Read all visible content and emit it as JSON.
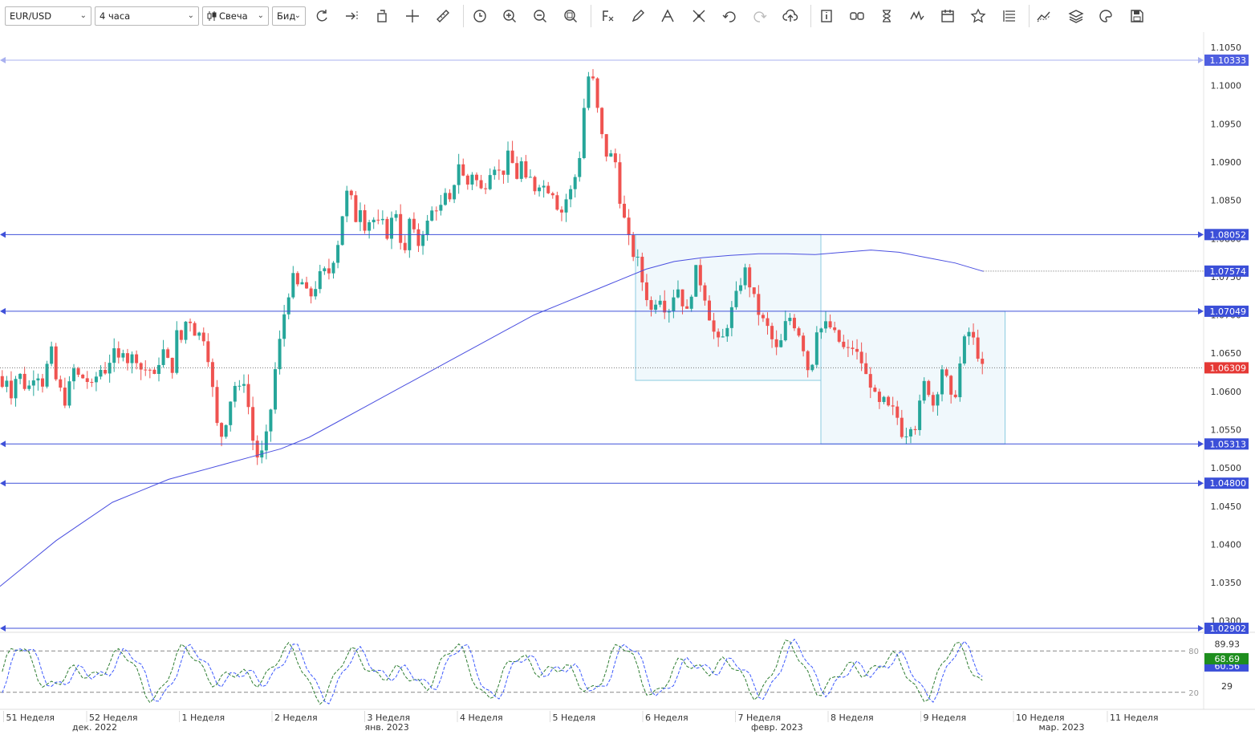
{
  "toolbar": {
    "symbol": "EUR/USD",
    "timeframe": "4 часа",
    "chart_type": "Свеча",
    "price_type": "Бид"
  },
  "colors": {
    "bull": "#26a69a",
    "bear": "#ef5350",
    "level_line": "#3f51d9",
    "ma": "#4a4fe0",
    "box_fill": "#e6f3fa",
    "box_stroke": "#8ccbe0",
    "current_price": "#e53935",
    "stoch_k": "#2e7d32",
    "stoch_d": "#3d5afe"
  },
  "price_axis": {
    "ticks": [
      "1.1050",
      "1.1000",
      "1.0950",
      "1.0900",
      "1.0850",
      "1.0800",
      "1.0750",
      "1.0700",
      "1.0650",
      "1.0600",
      "1.0550",
      "1.0500",
      "1.0450",
      "1.0400",
      "1.0350",
      "1.0300"
    ]
  },
  "levels": [
    {
      "label": "1.10333",
      "price": 1.10333,
      "style": "light"
    },
    {
      "label": "1.08052",
      "price": 1.08052,
      "style": "solid"
    },
    {
      "label": "1.07049",
      "price": 1.07049,
      "style": "solid"
    },
    {
      "label": "1.05313",
      "price": 1.05313,
      "style": "solid"
    },
    {
      "label": "1.04800",
      "price": 1.048,
      "style": "solid"
    },
    {
      "label": "1.02902",
      "price": 1.02902,
      "style": "solid"
    }
  ],
  "ma_label": {
    "label": "1.07574",
    "price": 1.07574
  },
  "current_price": {
    "label": "1.06309",
    "price": 1.06309
  },
  "rectangles": [
    {
      "x1": 0.528,
      "x2": 0.682,
      "top": 1.08052,
      "bottom": 1.06145
    },
    {
      "x1": 0.682,
      "x2": 0.835,
      "top": 1.07049,
      "bottom": 1.05313
    }
  ],
  "stochastic": {
    "upper_level": "80",
    "lower_level": "20",
    "upper_value": 89.93,
    "lower_value": 29,
    "upper_value_label": "89.93",
    "lower_value_label": "29",
    "k_value": "68.69",
    "d_value": "60.56"
  },
  "time_axis": {
    "weeks": [
      {
        "label": "51 Неделя",
        "x": 0.003
      },
      {
        "label": "52 Неделя",
        "x": 0.072
      },
      {
        "label": "1 Неделя",
        "x": 0.149
      },
      {
        "label": "2 Неделя",
        "x": 0.226
      },
      {
        "label": "3 Неделя",
        "x": 0.303
      },
      {
        "label": "4 Неделя",
        "x": 0.38
      },
      {
        "label": "5 Неделя",
        "x": 0.457
      },
      {
        "label": "6 Неделя",
        "x": 0.534
      },
      {
        "label": "7 Неделя",
        "x": 0.611
      },
      {
        "label": "8 Неделя",
        "x": 0.688
      },
      {
        "label": "9 Неделя",
        "x": 0.765
      },
      {
        "label": "10 Неделя",
        "x": 0.842
      },
      {
        "label": "11 Неделя",
        "x": 0.92
      }
    ],
    "months": [
      {
        "label": "дек. 2022",
        "x": 0.058
      },
      {
        "label": "янв. 2023",
        "x": 0.301
      },
      {
        "label": "февр. 2023",
        "x": 0.622
      },
      {
        "label": "мар. 2023",
        "x": 0.861
      }
    ]
  },
  "chart_data": {
    "type": "candlestick",
    "symbol": "EUR/USD",
    "timeframe": "4 часа",
    "y_range": [
      1.0285,
      1.107
    ],
    "candles_end_fraction": 0.818,
    "close_path": [
      1.062,
      1.0605,
      1.062,
      1.059,
      1.063,
      1.0615,
      1.06,
      1.0615,
      1.063,
      1.0605,
      1.063,
      1.0655,
      1.0615,
      1.06,
      1.0585,
      1.0615,
      1.0635,
      1.061,
      1.0625,
      1.06,
      1.0615,
      1.063,
      1.0625,
      1.064,
      1.065,
      1.064,
      1.066,
      1.0635,
      1.065,
      1.064,
      1.062,
      1.064,
      1.061,
      1.0635,
      1.0655,
      1.064,
      1.063,
      1.068,
      1.0665,
      1.07,
      1.069,
      1.067,
      1.068,
      1.066,
      1.062,
      1.056,
      1.054,
      1.056,
      1.059,
      1.061,
      1.06,
      1.062,
      1.056,
      1.052,
      1.051,
      1.053,
      1.056,
      1.062,
      1.066,
      1.07,
      1.073,
      1.075,
      1.0735,
      1.0745,
      1.072,
      1.073,
      1.0745,
      1.076,
      1.075,
      1.077,
      1.079,
      1.083,
      1.086,
      1.085,
      1.082,
      1.085,
      1.08,
      1.084,
      1.081,
      1.083,
      1.08,
      1.082,
      1.084,
      1.08,
      1.078,
      1.083,
      1.08,
      1.079,
      1.082,
      1.082,
      1.085,
      1.083,
      1.086,
      1.084,
      1.087,
      1.09,
      1.088,
      1.087,
      1.089,
      1.087,
      1.086,
      1.088,
      1.09,
      1.089,
      1.088,
      1.091,
      1.09,
      1.088,
      1.09,
      1.087,
      1.088,
      1.086,
      1.088,
      1.086,
      1.087,
      1.085,
      1.083,
      1.085,
      1.086,
      1.088,
      1.091,
      1.098,
      1.102,
      1.1,
      1.095,
      1.092,
      1.09,
      1.092,
      1.086,
      1.083,
      1.08,
      1.078,
      1.077,
      1.074,
      1.072,
      1.07,
      1.073,
      1.072,
      1.07,
      1.072,
      1.074,
      1.072,
      1.07,
      1.073,
      1.076,
      1.074,
      1.072,
      1.069,
      1.067,
      1.066,
      1.068,
      1.07,
      1.072,
      1.074,
      1.076,
      1.074,
      1.072,
      1.07,
      1.069,
      1.068,
      1.066,
      1.065,
      1.068,
      1.07,
      1.069,
      1.068,
      1.066,
      1.063,
      1.064,
      1.069,
      1.068,
      1.069,
      1.068,
      1.067,
      1.066,
      1.065,
      1.066,
      1.065,
      1.064,
      1.062,
      1.061,
      1.059,
      1.058,
      1.059,
      1.057,
      1.058,
      1.055,
      1.054,
      1.056,
      1.055,
      1.058,
      1.061,
      1.06,
      1.058,
      1.061,
      1.064,
      1.06,
      1.058,
      1.062,
      1.066,
      1.068,
      1.067,
      1.065,
      1.063
    ],
    "ma_path": [
      1.0345,
      1.0375,
      1.0405,
      1.043,
      1.0455,
      1.047,
      1.0485,
      1.0495,
      1.0505,
      1.0515,
      1.0525,
      1.054,
      1.056,
      1.058,
      1.06,
      1.062,
      1.064,
      1.066,
      1.068,
      1.07,
      1.0715,
      1.073,
      1.0745,
      1.076,
      1.077,
      1.0775,
      1.0778,
      1.078,
      1.078,
      1.0779,
      1.0782,
      1.0785,
      1.0782,
      1.0775,
      1.0768,
      1.0757
    ],
    "ma_end_fraction": 0.817
  }
}
